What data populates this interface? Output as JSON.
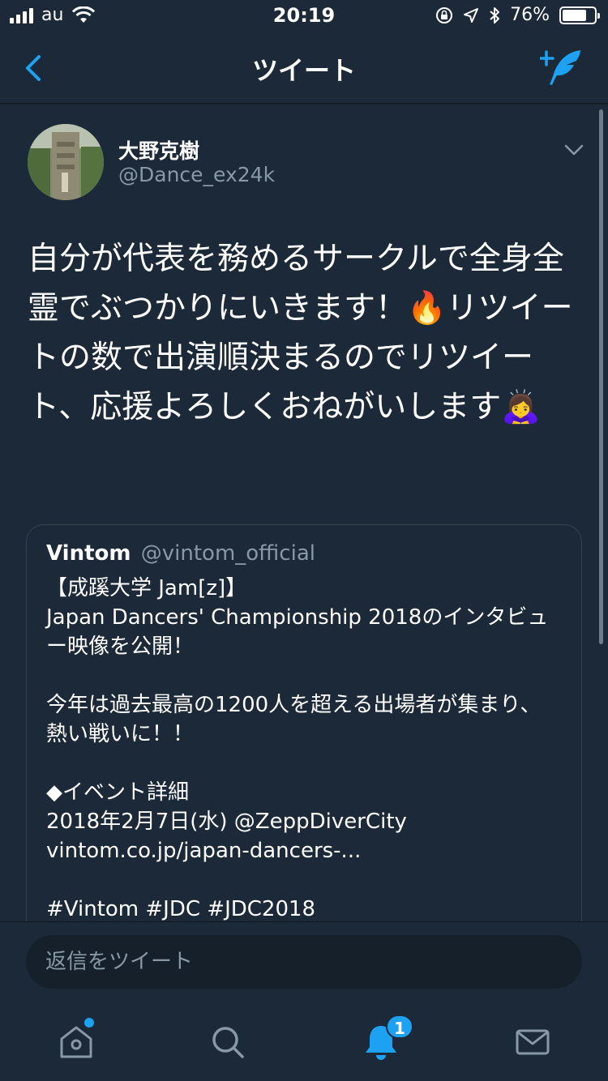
{
  "status_bar": {
    "carrier": "au",
    "time": "20:19",
    "battery": "76%",
    "battery_level": 0.76
  },
  "nav": {
    "title": "ツイート"
  },
  "tweet": {
    "display_name": "大野克樹",
    "handle": "@Dance_ex24k",
    "text_part1": "自分が代表を務めるサークルで全身全霊でぶつかりにいきます！",
    "emoji_fire": "🔥",
    "text_part2": "リツイートの数で出演順決まるのでリツイート、応援よろしくおねがいします",
    "emoji_bow": "🙇‍♀️"
  },
  "quoted_tweet": {
    "name": "Vintom",
    "handle": "@vintom_official",
    "body": "【成蹊大学 Jam[z]】\nJapan Dancers' Championship 2018のインタビュー映像を公開！\n\n今年は過去最高の1200人を超える出場者が集まり、熱い戦いに！！\n\n◆イベント詳細\n2018年2月7日(水) @ZeppDiverCity\nvintom.co.jp/japan-dancers-...\n\n#Vintom #JDC #JDC2018"
  },
  "reply": {
    "placeholder": "返信をツイート"
  },
  "tabs": {
    "notifications_badge": "1"
  },
  "colors": {
    "accent": "#1da1f2",
    "background": "#1c2938",
    "secondary_text": "#8899a6"
  }
}
